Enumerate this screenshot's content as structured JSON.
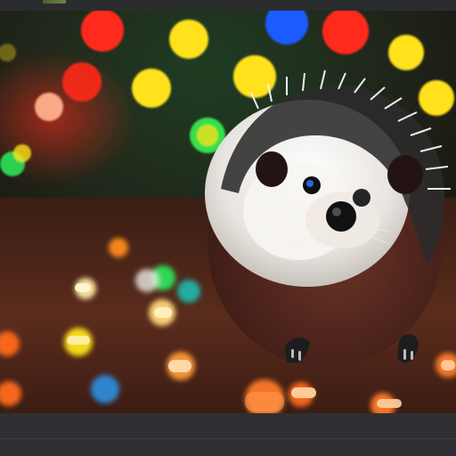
{
  "window": {
    "bottom_caption": ""
  },
  "image": {
    "subject": "hedgehog-among-string-lights",
    "palette": {
      "background_dark": "#2a2b2d",
      "floor": "#5a2e1c",
      "bokeh_red": "#ff2a1a",
      "bokeh_yellow": "#ffe21c",
      "bokeh_blue": "#1f5cff",
      "bokeh_green": "#2ee35a",
      "hedgehog_fur": "#f1eee9",
      "hedgehog_body": "#5b2a22"
    }
  }
}
